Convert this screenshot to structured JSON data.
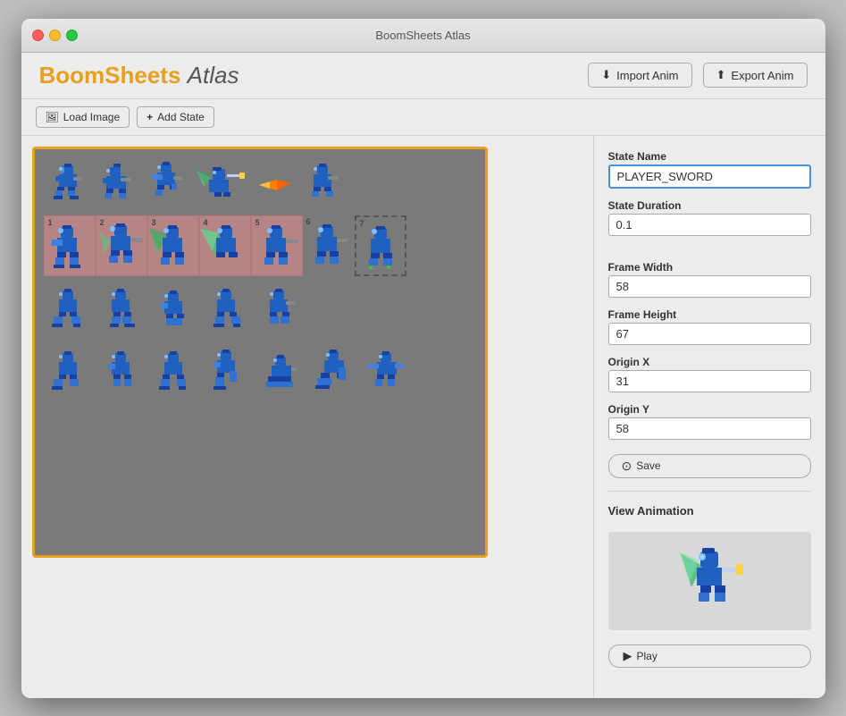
{
  "window": {
    "title": "BoomSheets Atlas",
    "traffic_lights": [
      "close",
      "minimize",
      "maximize"
    ]
  },
  "header": {
    "logo_boom": "BoomSheets",
    "logo_atlas": "Atlas",
    "import_btn": "Import Anim",
    "export_btn": "Export Anim"
  },
  "toolbar": {
    "load_image_btn": "Load Image",
    "add_state_btn": "Add State"
  },
  "right_panel": {
    "state_name_label": "State Name",
    "state_name_value": "PLAYER_SWORD",
    "state_duration_label": "State Duration",
    "state_duration_value": "0.1",
    "frame_width_label": "Frame Width",
    "frame_width_value": "58",
    "frame_height_label": "Frame Height",
    "frame_height_value": "67",
    "origin_x_label": "Origin X",
    "origin_x_value": "31",
    "origin_y_label": "Origin Y",
    "origin_y_value": "58",
    "save_btn": "Save",
    "view_animation_label": "View Animation",
    "play_btn": "Play"
  },
  "frames": {
    "row3_labels": [
      "1",
      "2",
      "3",
      "4",
      "5",
      "6",
      "7"
    ]
  }
}
